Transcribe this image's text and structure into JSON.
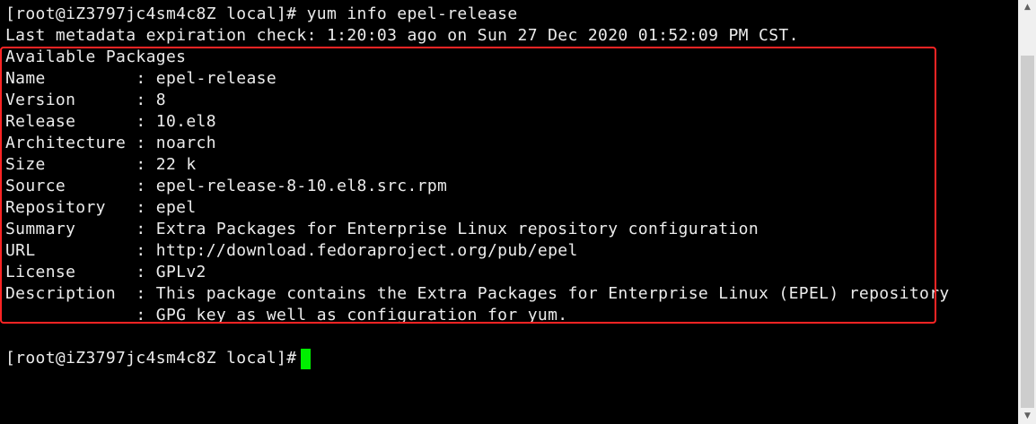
{
  "terminal": {
    "lines": [
      "[root@iZ3797jc4sm4c8Z local]# yum info epel-release",
      "Last metadata expiration check: 1:20:03 ago on Sun 27 Dec 2020 01:52:09 PM CST.",
      "Available Packages",
      "Name         : epel-release",
      "Version      : 8",
      "Release      : 10.el8",
      "Architecture : noarch",
      "Size         : 22 k",
      "Source       : epel-release-8-10.el8.src.rpm",
      "Repository   : epel",
      "Summary      : Extra Packages for Enterprise Linux repository configuration",
      "URL          : http://download.fedoraproject.org/pub/epel",
      "License      : GPLv2",
      "Description  : This package contains the Extra Packages for Enterprise Linux (EPEL) repository",
      "             : GPG key as well as configuration for yum.",
      "",
      "[root@iZ3797jc4sm4c8Z local]# "
    ]
  },
  "colors": {
    "background": "#000000",
    "text": "#ececec",
    "cursor": "#00ee00",
    "highlight_border": "#ff2424",
    "scrollbar_track": "#f0f0f0",
    "scrollbar_thumb": "#cdcdcd"
  },
  "scrollbar": {
    "up_icon": "chevron-up-icon",
    "down_icon": "chevron-down-icon"
  }
}
